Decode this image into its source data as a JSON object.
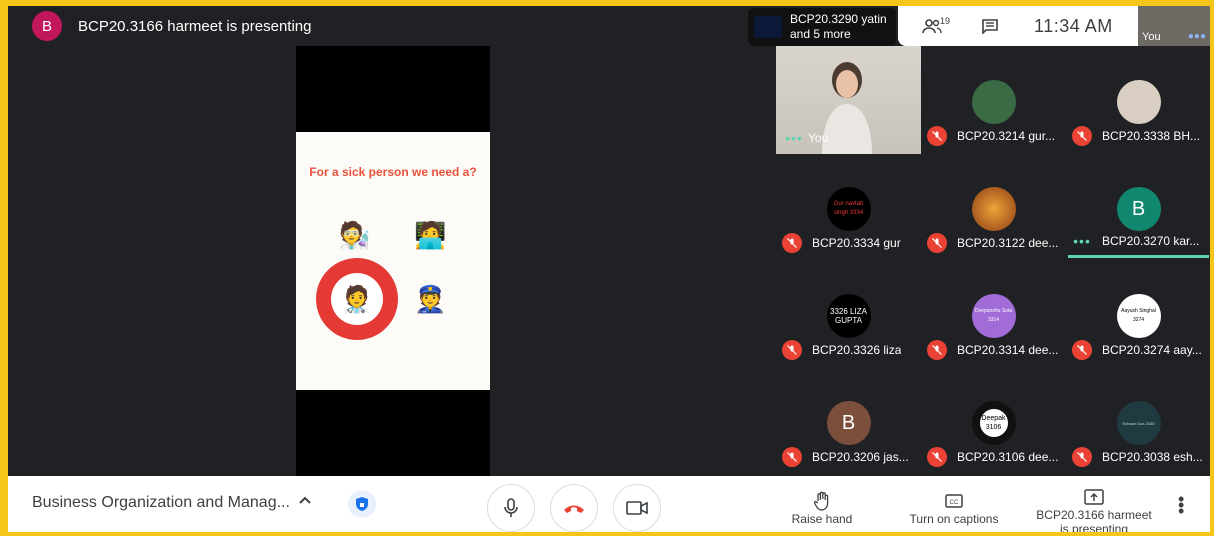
{
  "presenter": {
    "avatar_letter": "B",
    "title": "BCP20.3166 harmeet is presenting"
  },
  "slide": {
    "question": "For a sick person we need a?",
    "options": [
      "scientist",
      "technologist",
      "doctor",
      "police officer"
    ]
  },
  "overlay": {
    "more_text_line1": "BCP20.3290 yatin",
    "more_text_line2": "and 5 more"
  },
  "top_bar": {
    "participants_count": "19",
    "time": "11:34 AM",
    "self_label": "You"
  },
  "self_tile": {
    "label": "You"
  },
  "participants": [
    {
      "name": "BCP20.3214 gur...",
      "muted": true
    },
    {
      "name": "BCP20.3338 BH...",
      "muted": true
    },
    {
      "name": "BCP20.3334 gur",
      "muted": true,
      "avatar_text": "Gur navtab singh 3334"
    },
    {
      "name": "BCP20.3122 dee...",
      "muted": true
    },
    {
      "name": "BCP20.3270 kar...",
      "muted": false,
      "avatar_letter": "B"
    },
    {
      "name": "BCP20.3326 liza",
      "muted": true,
      "avatar_text": "3326 LIZA GUPTA"
    },
    {
      "name": "BCP20.3314 dee...",
      "muted": true,
      "avatar_text": "Deepanshu Sota 3314"
    },
    {
      "name": "BCP20.3274 aay...",
      "muted": true,
      "avatar_text": "Aayush Singhal 3274"
    },
    {
      "name": "BCP20.3206 jas...",
      "muted": true,
      "avatar_letter": "B"
    },
    {
      "name": "BCP20.3106 dee...",
      "muted": true,
      "avatar_text": "Deepak 3106"
    },
    {
      "name": "BCP20.3038 esh...",
      "muted": true,
      "avatar_text": "Eshaan Dua 3038"
    }
  ],
  "bottom_bar": {
    "meeting_title": "Business Organization and Manag...",
    "raise_hand": "Raise hand",
    "captions": "Turn on captions",
    "presenting_line1": "BCP20.3166 harmeet",
    "presenting_line2": "is presenting"
  },
  "colors": {
    "frame": "#f5c518",
    "background": "#202124",
    "mute": "#ea4335",
    "speaking": "#5fd4b1",
    "hangup": "#ea4335"
  }
}
